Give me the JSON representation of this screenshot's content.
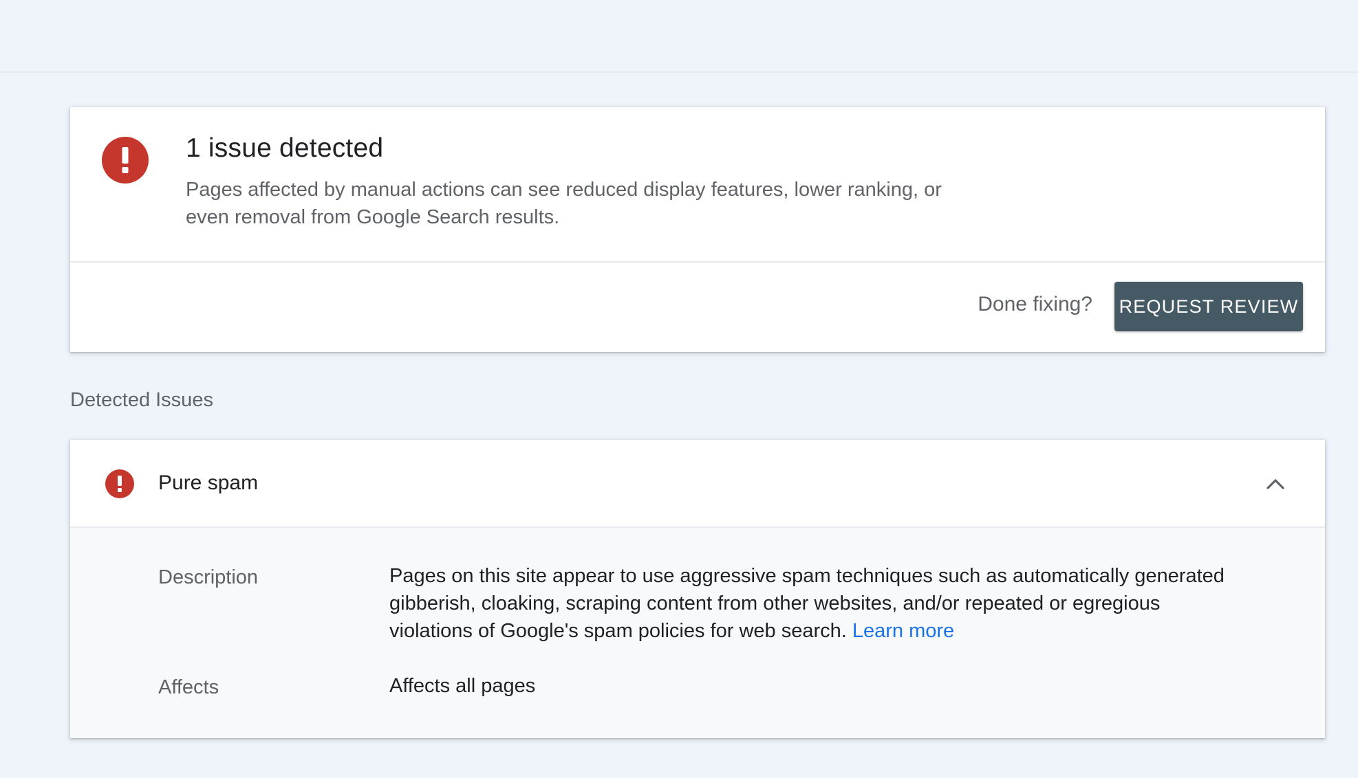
{
  "summary": {
    "icon": "error-icon",
    "title": "1 issue detected",
    "text": "Pages affected by manual actions can see reduced display features, lower ranking, or even removal from Google Search results.",
    "done_label": "Done fixing?",
    "review_button_label": "REQUEST REVIEW"
  },
  "detected_issues": {
    "heading": "Detected Issues",
    "items": [
      {
        "icon": "error-icon",
        "title": "Pure spam",
        "expanded": true,
        "description_label": "Description",
        "description_text": "Pages on this site appear to use aggressive spam techniques such as automatically generated gibberish, cloaking, scraping content from other websites, and/or repeated or egregious violations of Google's spam policies for web search.",
        "learn_more_label": "Learn more",
        "affects_label": "Affects",
        "affects_value": "Affects all pages"
      }
    ]
  },
  "colors": {
    "background": "#eff3fa",
    "error_red": "#c5372c",
    "button": "#455a64",
    "link": "#1a73e8"
  }
}
